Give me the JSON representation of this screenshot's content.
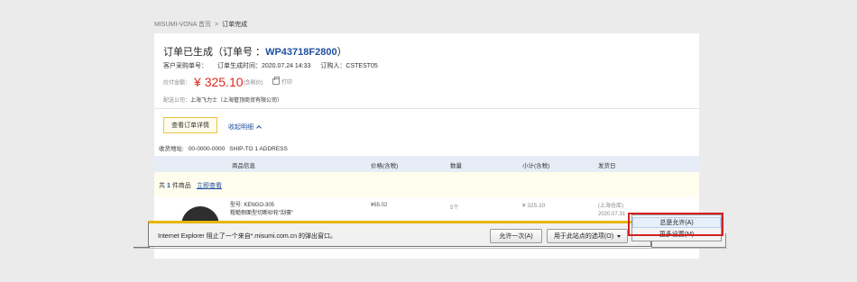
{
  "breadcrumb": {
    "home": "MISUMI-VONA 首页",
    "separator": ">",
    "current": "订单完成"
  },
  "order": {
    "title_prefix": "订单已生成（",
    "order_label": "订单号 ：",
    "order_number": "WP43718F2800",
    "title_suffix": "）",
    "customer_po_label": "客户采购单号：",
    "created_time": "订单生成时间：2020.07.24 14:33",
    "buyer": "订购人：CSTEST05",
    "amount_label": "应付金额：",
    "amount": "¥ 325.10",
    "tax_note": "(含税价)",
    "print_label": "打印",
    "carrier_label": "配送公司：",
    "carrier_value": "上海飞力士（上海管顶商贸有限公司）",
    "detail_button": "查看订单详情",
    "collapse_link": "收起明细",
    "address_label": "收货地址:",
    "address_code": "00-0000-0000",
    "address_value": "SHIP-TO 1 ADDRESS"
  },
  "table": {
    "headers": [
      "商品信息",
      "价格(含税)",
      "数量",
      "小计(含税)",
      "发货日"
    ],
    "summary_prefix": "共",
    "summary_count": "1",
    "summary_suffix": "件商品",
    "view_now": "立即查看",
    "item": {
      "model": "型号: KENGO-305",
      "name": "粗糙侧面型切断砂轮\"刮豪\"",
      "price": "¥65.02",
      "qty": "5个",
      "subtotal": "¥ 325.10",
      "warehouse": "(上海仓库)",
      "ship_date": "2020.07.31"
    }
  },
  "ie_bar": {
    "message": "Internet Explorer 阻止了一个来自*.misumi.com.cn 的弹出窗口。",
    "allow_once": "允许一次(A)",
    "options": "用于此站点的选项(O)",
    "menu": {
      "always_allow": "总是允许(A)",
      "more_settings": "更多设置(M)"
    }
  },
  "colors": {
    "accent": "#1f4fa0",
    "price": "#e0281e",
    "highlight_box": "#d41f1f",
    "ie_bar_top": "#e8b500"
  }
}
